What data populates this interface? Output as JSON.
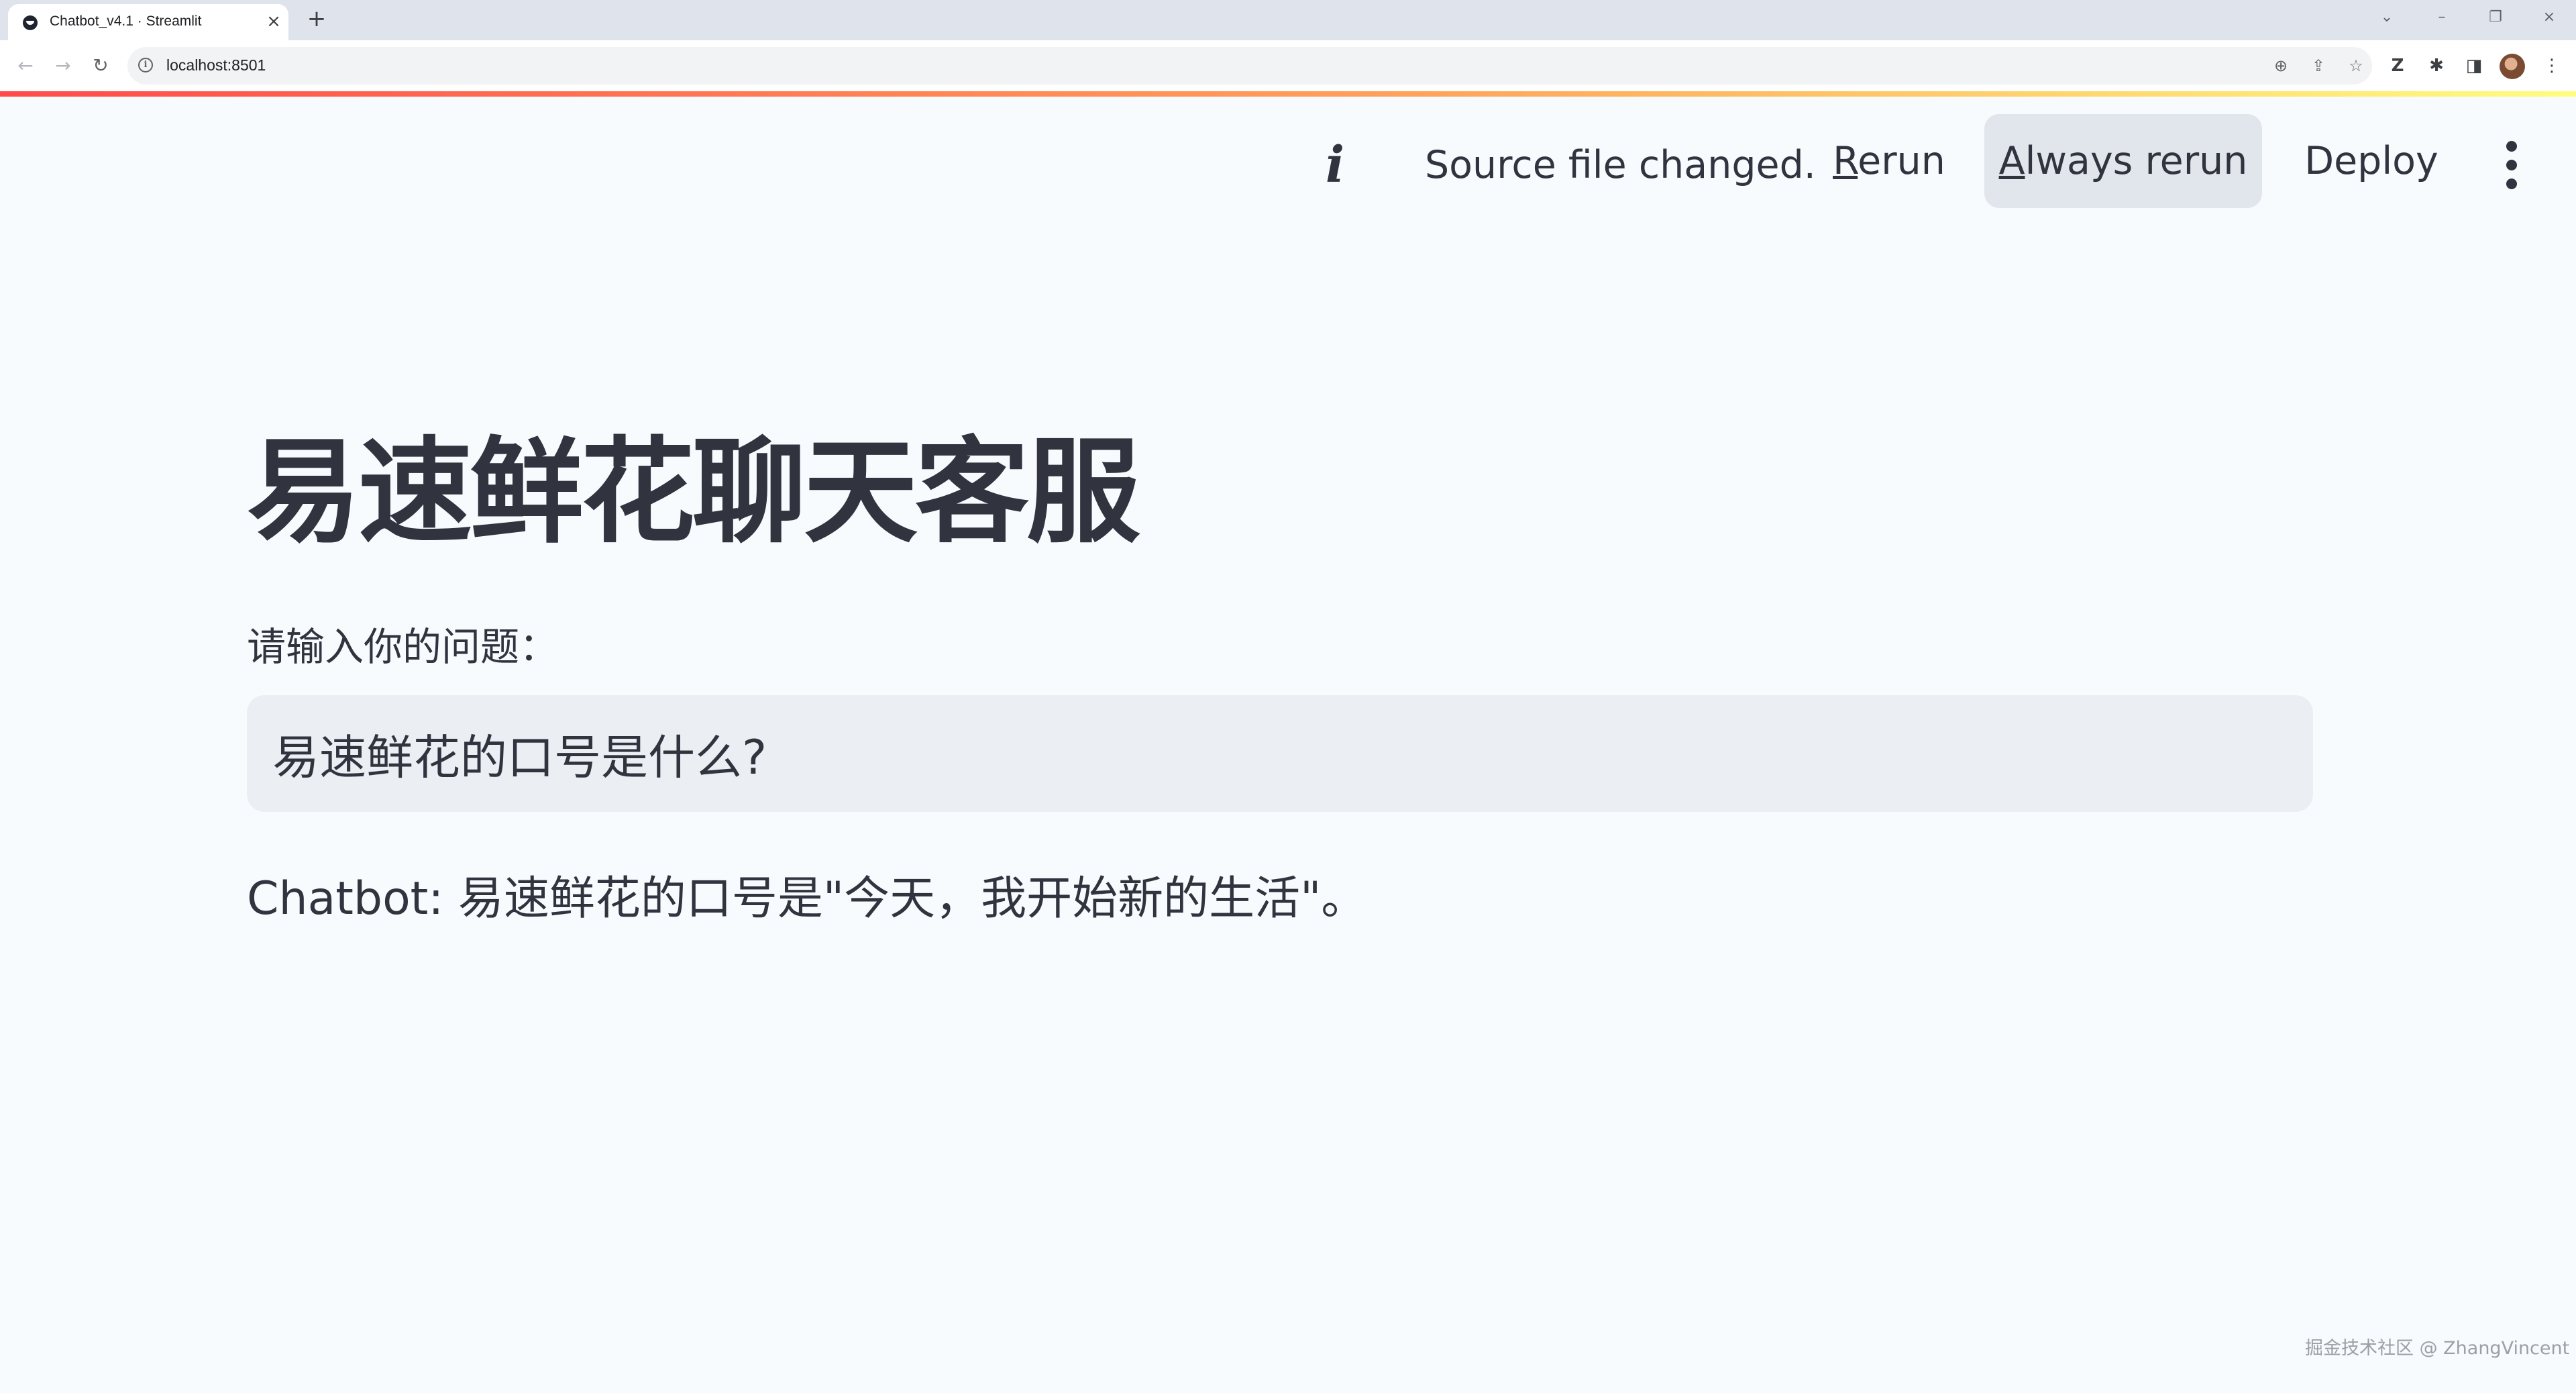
{
  "browser": {
    "tab": {
      "title": "Chatbot_v4.1 · Streamlit",
      "close_icon": "×"
    },
    "new_tab_icon": "+",
    "window_controls": {
      "tab_search": "⌄",
      "minimize": "–",
      "restore": "❐",
      "close": "×"
    },
    "nav": {
      "back": "←",
      "forward": "→",
      "reload": "↻"
    },
    "address_bar": {
      "url": "localhost:8501",
      "site_info_icon": "i"
    },
    "omnibox_icons": {
      "zoom": "⊕",
      "share": "⇪",
      "bookmark": "☆"
    },
    "extensions": {
      "z_extension": "Z",
      "puzzle": "✱",
      "side_panel": "◨",
      "menu": "⋮"
    }
  },
  "colors": {
    "decoration_gradient": [
      "#ff4b4b",
      "#ffa35a",
      "#fffd80"
    ],
    "app_background": "#f8fbfe",
    "text": "#31333f",
    "input_background": "#ebeff4",
    "active_button_background": "#e1e6ed"
  },
  "header": {
    "status_icon": "i",
    "status_text": "Source file changed.",
    "rerun_label": "Rerun",
    "always_rerun_label": "Always rerun",
    "deploy_label": "Deploy"
  },
  "main": {
    "title": "易速鲜花聊天客服",
    "input_label": "请输入你的问题：",
    "input_value": "易速鲜花的口号是什么?",
    "response": "Chatbot: 易速鲜花的口号是\"今天，我开始新的生活\"。"
  },
  "watermark": "掘金技术社区 @ ZhangVincent"
}
